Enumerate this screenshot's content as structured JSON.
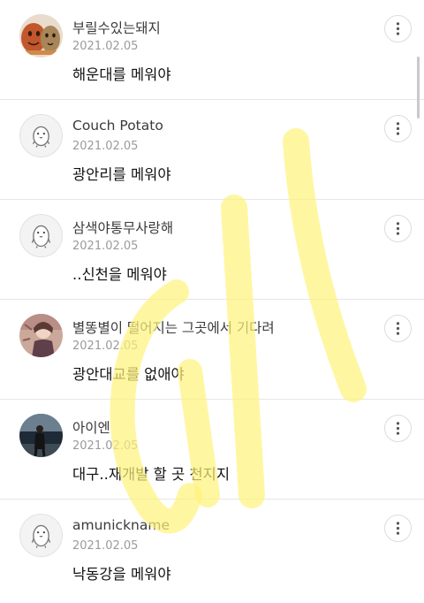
{
  "comments": [
    {
      "author": "부릴수있는돼지",
      "date": "2021.02.05",
      "text": "해운대를 메워야",
      "avatar": "potato-characters-avatar"
    },
    {
      "author": "Couch Potato",
      "date": "2021.02.05",
      "text": "광안리를 메워야",
      "avatar": "default-penguin-avatar"
    },
    {
      "author": "삼색야통무사랑해",
      "date": "2021.02.05",
      "text": "..신천을 메워야",
      "avatar": "default-penguin-avatar"
    },
    {
      "author": "별똥별이 떨어지는 그곳에서 기다려",
      "date": "2021.02.05",
      "text": "광안대교를 없애야",
      "avatar": "anime-character-avatar"
    },
    {
      "author": "아이엔",
      "date": "2021.02.05",
      "text": "대구..재개발 할 곳 천지지",
      "avatar": "person-photo-avatar"
    },
    {
      "author": "amunickname",
      "date": "2021.02.05",
      "text": "낙동강을 메워야",
      "avatar": "default-penguin-avatar"
    }
  ],
  "more_icon": "more-dots-icon",
  "colors": {
    "author": "#3a3a3a",
    "date": "#9a9a9a",
    "text": "#111111",
    "divider": "#e6e6e6",
    "watermark": "#fff27a"
  }
}
